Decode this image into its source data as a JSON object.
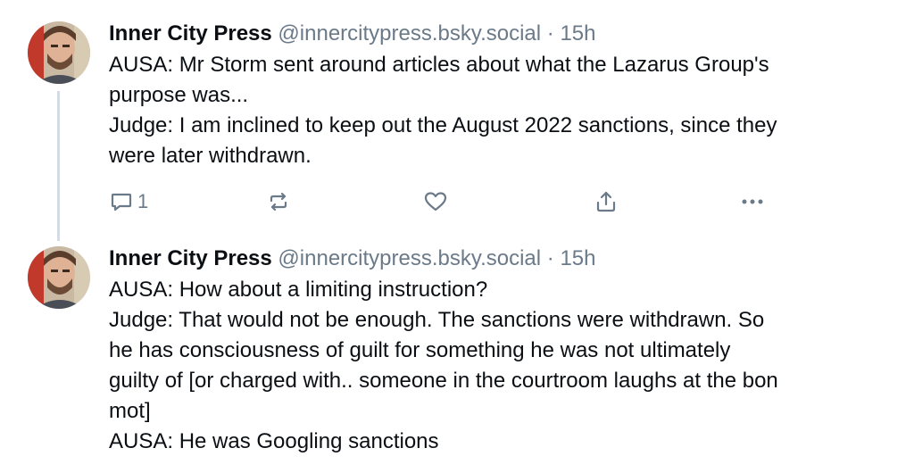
{
  "posts": [
    {
      "author_name": "Inner City Press",
      "handle": "@innercitypress.bsky.social",
      "separator": "·",
      "time": "15h",
      "lines": [
        "AUSA: Mr Storm sent around articles about what the Lazarus Group's",
        "purpose was...",
        "Judge: I am inclined to keep out the August 2022 sanctions, since they",
        "were later withdrawn."
      ],
      "reply_count": "1",
      "action_icons": [
        "reply-icon",
        "repost-icon",
        "like-icon",
        "share-icon",
        "more-icon"
      ]
    },
    {
      "author_name": "Inner City Press",
      "handle": "@innercitypress.bsky.social",
      "separator": "·",
      "time": "15h",
      "lines": [
        "AUSA: How about a limiting instruction?",
        "Judge: That would not be enough. The sanctions were withdrawn. So",
        "he has consciousness of guilt for something he was not ultimately",
        "guilty of [or charged with.. someone in the courtroom laughs at the bon",
        "mot]",
        "AUSA: He was Googling sanctions"
      ]
    }
  ],
  "colors": {
    "text": "#0b0f14",
    "muted": "#6b7a89",
    "thread_line": "#d4dbe2"
  }
}
